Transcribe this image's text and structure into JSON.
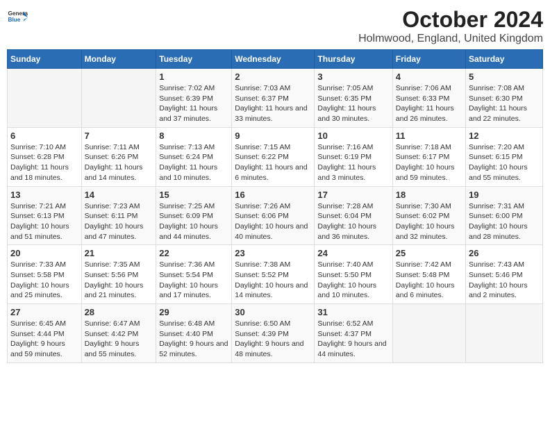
{
  "header": {
    "logo_general": "General",
    "logo_blue": "Blue",
    "title": "October 2024",
    "subtitle": "Holmwood, England, United Kingdom"
  },
  "days_of_week": [
    "Sunday",
    "Monday",
    "Tuesday",
    "Wednesday",
    "Thursday",
    "Friday",
    "Saturday"
  ],
  "weeks": [
    {
      "days": [
        {
          "number": "",
          "sunrise": "",
          "sunset": "",
          "daylight": "",
          "empty": true
        },
        {
          "number": "",
          "sunrise": "",
          "sunset": "",
          "daylight": "",
          "empty": true
        },
        {
          "number": "1",
          "sunrise": "Sunrise: 7:02 AM",
          "sunset": "Sunset: 6:39 PM",
          "daylight": "Daylight: 11 hours and 37 minutes."
        },
        {
          "number": "2",
          "sunrise": "Sunrise: 7:03 AM",
          "sunset": "Sunset: 6:37 PM",
          "daylight": "Daylight: 11 hours and 33 minutes."
        },
        {
          "number": "3",
          "sunrise": "Sunrise: 7:05 AM",
          "sunset": "Sunset: 6:35 PM",
          "daylight": "Daylight: 11 hours and 30 minutes."
        },
        {
          "number": "4",
          "sunrise": "Sunrise: 7:06 AM",
          "sunset": "Sunset: 6:33 PM",
          "daylight": "Daylight: 11 hours and 26 minutes."
        },
        {
          "number": "5",
          "sunrise": "Sunrise: 7:08 AM",
          "sunset": "Sunset: 6:30 PM",
          "daylight": "Daylight: 11 hours and 22 minutes."
        }
      ]
    },
    {
      "days": [
        {
          "number": "6",
          "sunrise": "Sunrise: 7:10 AM",
          "sunset": "Sunset: 6:28 PM",
          "daylight": "Daylight: 11 hours and 18 minutes."
        },
        {
          "number": "7",
          "sunrise": "Sunrise: 7:11 AM",
          "sunset": "Sunset: 6:26 PM",
          "daylight": "Daylight: 11 hours and 14 minutes."
        },
        {
          "number": "8",
          "sunrise": "Sunrise: 7:13 AM",
          "sunset": "Sunset: 6:24 PM",
          "daylight": "Daylight: 11 hours and 10 minutes."
        },
        {
          "number": "9",
          "sunrise": "Sunrise: 7:15 AM",
          "sunset": "Sunset: 6:22 PM",
          "daylight": "Daylight: 11 hours and 6 minutes."
        },
        {
          "number": "10",
          "sunrise": "Sunrise: 7:16 AM",
          "sunset": "Sunset: 6:19 PM",
          "daylight": "Daylight: 11 hours and 3 minutes."
        },
        {
          "number": "11",
          "sunrise": "Sunrise: 7:18 AM",
          "sunset": "Sunset: 6:17 PM",
          "daylight": "Daylight: 10 hours and 59 minutes."
        },
        {
          "number": "12",
          "sunrise": "Sunrise: 7:20 AM",
          "sunset": "Sunset: 6:15 PM",
          "daylight": "Daylight: 10 hours and 55 minutes."
        }
      ]
    },
    {
      "days": [
        {
          "number": "13",
          "sunrise": "Sunrise: 7:21 AM",
          "sunset": "Sunset: 6:13 PM",
          "daylight": "Daylight: 10 hours and 51 minutes."
        },
        {
          "number": "14",
          "sunrise": "Sunrise: 7:23 AM",
          "sunset": "Sunset: 6:11 PM",
          "daylight": "Daylight: 10 hours and 47 minutes."
        },
        {
          "number": "15",
          "sunrise": "Sunrise: 7:25 AM",
          "sunset": "Sunset: 6:09 PM",
          "daylight": "Daylight: 10 hours and 44 minutes."
        },
        {
          "number": "16",
          "sunrise": "Sunrise: 7:26 AM",
          "sunset": "Sunset: 6:06 PM",
          "daylight": "Daylight: 10 hours and 40 minutes."
        },
        {
          "number": "17",
          "sunrise": "Sunrise: 7:28 AM",
          "sunset": "Sunset: 6:04 PM",
          "daylight": "Daylight: 10 hours and 36 minutes."
        },
        {
          "number": "18",
          "sunrise": "Sunrise: 7:30 AM",
          "sunset": "Sunset: 6:02 PM",
          "daylight": "Daylight: 10 hours and 32 minutes."
        },
        {
          "number": "19",
          "sunrise": "Sunrise: 7:31 AM",
          "sunset": "Sunset: 6:00 PM",
          "daylight": "Daylight: 10 hours and 28 minutes."
        }
      ]
    },
    {
      "days": [
        {
          "number": "20",
          "sunrise": "Sunrise: 7:33 AM",
          "sunset": "Sunset: 5:58 PM",
          "daylight": "Daylight: 10 hours and 25 minutes."
        },
        {
          "number": "21",
          "sunrise": "Sunrise: 7:35 AM",
          "sunset": "Sunset: 5:56 PM",
          "daylight": "Daylight: 10 hours and 21 minutes."
        },
        {
          "number": "22",
          "sunrise": "Sunrise: 7:36 AM",
          "sunset": "Sunset: 5:54 PM",
          "daylight": "Daylight: 10 hours and 17 minutes."
        },
        {
          "number": "23",
          "sunrise": "Sunrise: 7:38 AM",
          "sunset": "Sunset: 5:52 PM",
          "daylight": "Daylight: 10 hours and 14 minutes."
        },
        {
          "number": "24",
          "sunrise": "Sunrise: 7:40 AM",
          "sunset": "Sunset: 5:50 PM",
          "daylight": "Daylight: 10 hours and 10 minutes."
        },
        {
          "number": "25",
          "sunrise": "Sunrise: 7:42 AM",
          "sunset": "Sunset: 5:48 PM",
          "daylight": "Daylight: 10 hours and 6 minutes."
        },
        {
          "number": "26",
          "sunrise": "Sunrise: 7:43 AM",
          "sunset": "Sunset: 5:46 PM",
          "daylight": "Daylight: 10 hours and 2 minutes."
        }
      ]
    },
    {
      "days": [
        {
          "number": "27",
          "sunrise": "Sunrise: 6:45 AM",
          "sunset": "Sunset: 4:44 PM",
          "daylight": "Daylight: 9 hours and 59 minutes."
        },
        {
          "number": "28",
          "sunrise": "Sunrise: 6:47 AM",
          "sunset": "Sunset: 4:42 PM",
          "daylight": "Daylight: 9 hours and 55 minutes."
        },
        {
          "number": "29",
          "sunrise": "Sunrise: 6:48 AM",
          "sunset": "Sunset: 4:40 PM",
          "daylight": "Daylight: 9 hours and 52 minutes."
        },
        {
          "number": "30",
          "sunrise": "Sunrise: 6:50 AM",
          "sunset": "Sunset: 4:39 PM",
          "daylight": "Daylight: 9 hours and 48 minutes."
        },
        {
          "number": "31",
          "sunrise": "Sunrise: 6:52 AM",
          "sunset": "Sunset: 4:37 PM",
          "daylight": "Daylight: 9 hours and 44 minutes."
        },
        {
          "number": "",
          "sunrise": "",
          "sunset": "",
          "daylight": "",
          "empty": true
        },
        {
          "number": "",
          "sunrise": "",
          "sunset": "",
          "daylight": "",
          "empty": true
        }
      ]
    }
  ]
}
